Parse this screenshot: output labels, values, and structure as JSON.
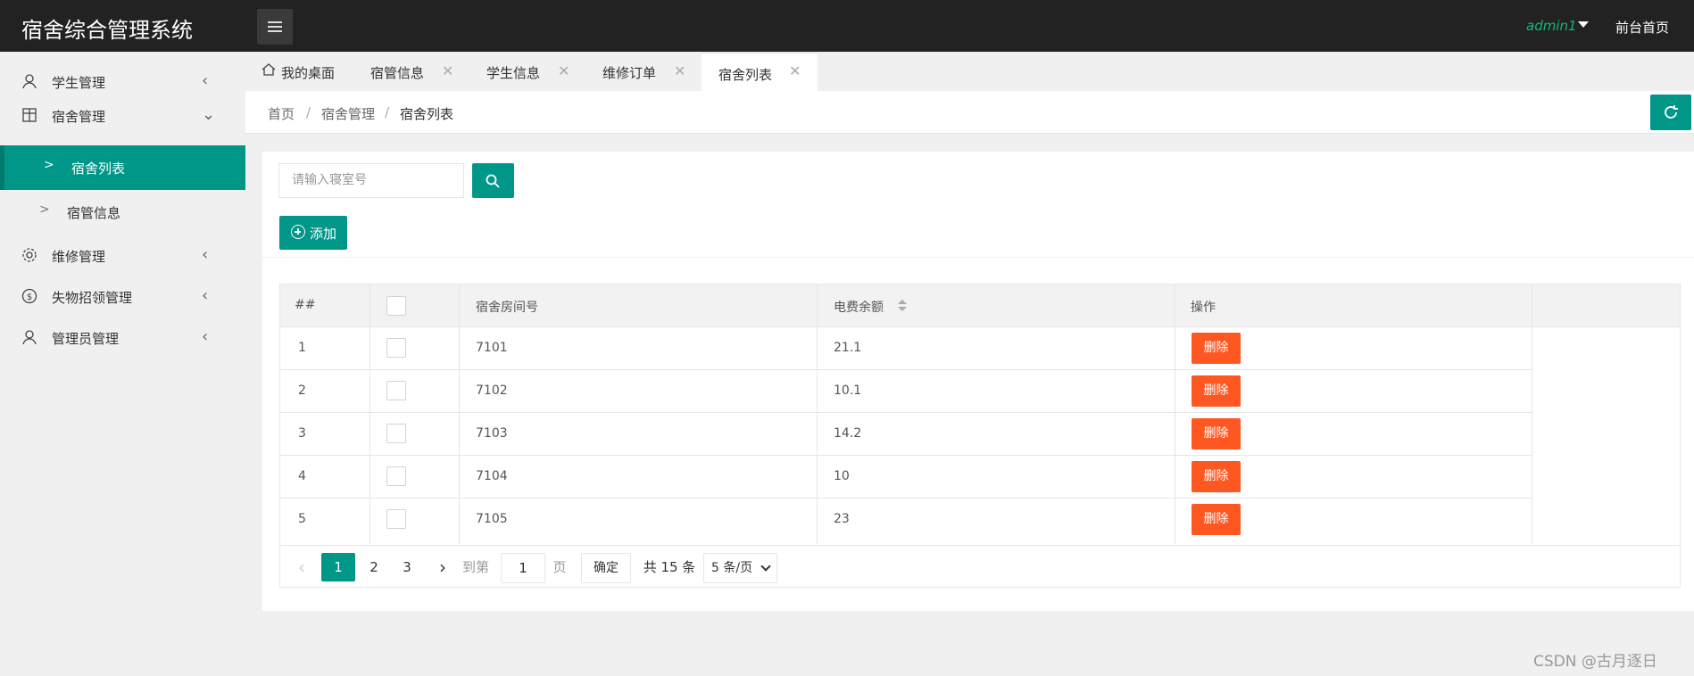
{
  "header": {
    "brand": "宿舍综合管理系统",
    "user": "admin1",
    "front_link": "前台首页"
  },
  "sidebar": {
    "items": [
      {
        "label": "学生管理",
        "icon": "user-icon",
        "arrow": "‹"
      },
      {
        "label": "宿舍管理",
        "icon": "building-icon",
        "arrow": "⌄"
      },
      {
        "label": "维修管理",
        "icon": "gear-icon",
        "arrow": "‹"
      },
      {
        "label": "失物招领管理",
        "icon": "dollar-icon",
        "arrow": "‹"
      },
      {
        "label": "管理员管理",
        "icon": "admin-icon",
        "arrow": "‹"
      }
    ],
    "subitems": [
      {
        "label": "宿舍列表",
        "active": true
      },
      {
        "label": "宿管信息",
        "active": false
      }
    ]
  },
  "tabs": [
    {
      "label": "我的桌面",
      "closable": false
    },
    {
      "label": "宿管信息",
      "closable": true
    },
    {
      "label": "学生信息",
      "closable": true
    },
    {
      "label": "维修订单",
      "closable": true
    },
    {
      "label": "宿舍列表",
      "closable": true,
      "active": true
    }
  ],
  "breadcrumb": [
    "首页",
    "宿舍管理",
    "宿舍列表"
  ],
  "search": {
    "placeholder": "请输入寝室号"
  },
  "toolbar": {
    "add_label": "添加"
  },
  "table": {
    "headers": [
      "##",
      "",
      "宿舍房间号",
      "电费余额",
      "操作"
    ],
    "rows": [
      {
        "index": "1",
        "room": "7101",
        "balance": "21.1",
        "action": "删除"
      },
      {
        "index": "2",
        "room": "7102",
        "balance": "10.1",
        "action": "删除"
      },
      {
        "index": "3",
        "room": "7103",
        "balance": "14.2",
        "action": "删除"
      },
      {
        "index": "4",
        "room": "7104",
        "balance": "10",
        "action": "删除"
      },
      {
        "index": "5",
        "room": "7105",
        "balance": "23",
        "action": "删除"
      }
    ]
  },
  "pager": {
    "prev": "‹",
    "pages": [
      "1",
      "2",
      "3"
    ],
    "current": "1",
    "next": "›",
    "goto_label": "到第",
    "goto_value": "1",
    "page_unit": "页",
    "confirm": "确定",
    "total": "共 15 条",
    "size": "5 条/页"
  },
  "watermark": "CSDN @古月逐日",
  "colors": {
    "accent": "#009688",
    "danger": "#ff5722",
    "header": "#222222",
    "user": "#16b777"
  }
}
